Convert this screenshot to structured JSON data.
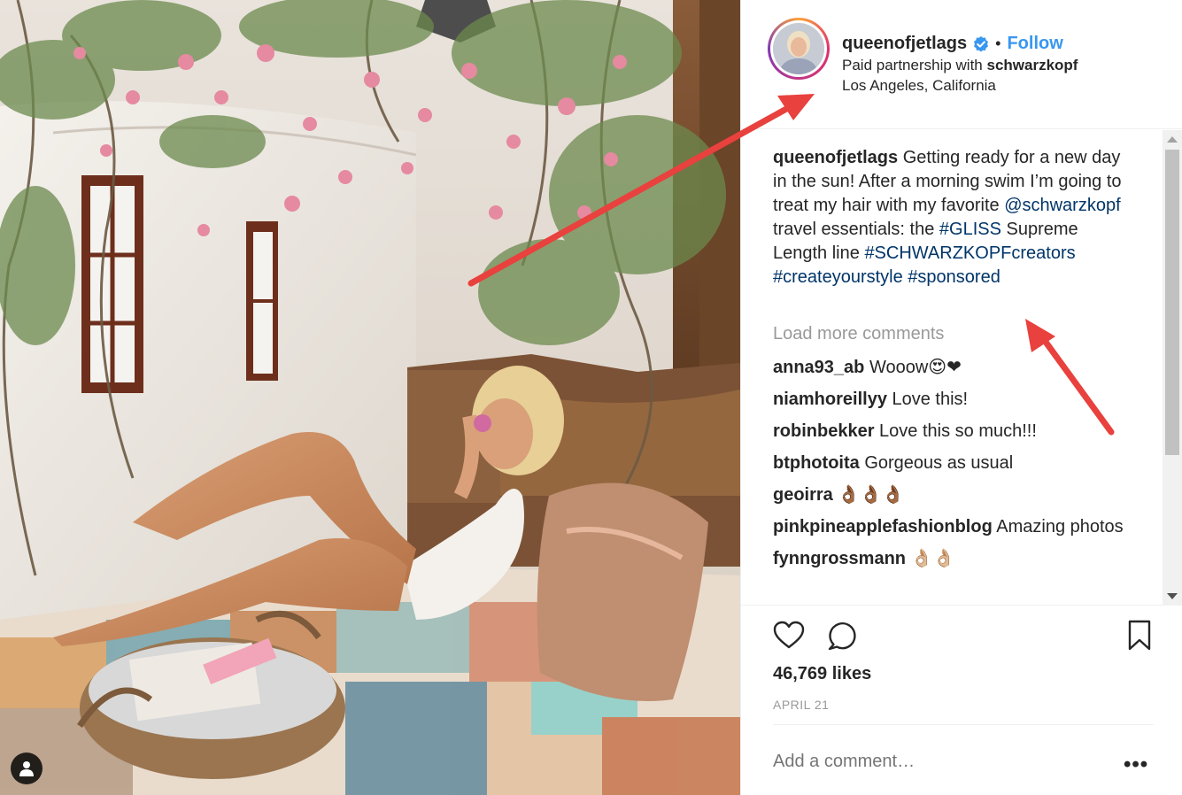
{
  "post": {
    "username": "queenofjetlags",
    "follow_label": "Follow",
    "separator": "•",
    "partnership_prefix": "Paid partnership with",
    "partner": "schwarzkopf",
    "location": "Los Angeles, California"
  },
  "caption": {
    "username": "queenofjetlags",
    "text_1": "Getting ready for a new day in the sun! After a morning swim I’m going to treat my hair with my favorite",
    "mention": "@schwarzkopf",
    "text_2": "travel essentials: the",
    "tag_gliss": "#GLISS",
    "text_3": "Supreme Length line",
    "tag_creators": "#SCHWARZKOPFcreators",
    "tag_style": "#createyourstyle",
    "tag_sponsored": "#sponsored"
  },
  "load_more": "Load more comments",
  "comments": [
    {
      "user": "anna93_ab",
      "text": "Wooow😍❤"
    },
    {
      "user": "niamhoreillyy",
      "text": "Love this!"
    },
    {
      "user": "robinbekker",
      "text": "Love this so much!!!"
    },
    {
      "user": "btphotoita",
      "text": "Gorgeous as usual"
    },
    {
      "user": "geoirra",
      "text": "👌🏾👌🏾👌🏾"
    },
    {
      "user": "pinkpineapplefashionblog",
      "text": "Amazing photos"
    },
    {
      "user": "fynngrossmann",
      "text": "👌🏼👌🏼"
    }
  ],
  "likes": "46,769 likes",
  "date": "APRIL 21",
  "add_comment_placeholder": "Add a comment…",
  "more_options": "•••",
  "icons": {
    "like": "heart-icon",
    "comment": "comment-bubble-icon",
    "save": "bookmark-icon",
    "verified": "verified-badge-icon",
    "tag": "user-tag-icon"
  },
  "colors": {
    "follow": "#3897f0",
    "hashtag": "#003569",
    "annotation_arrow": "#e8413e",
    "muted": "#999999"
  }
}
